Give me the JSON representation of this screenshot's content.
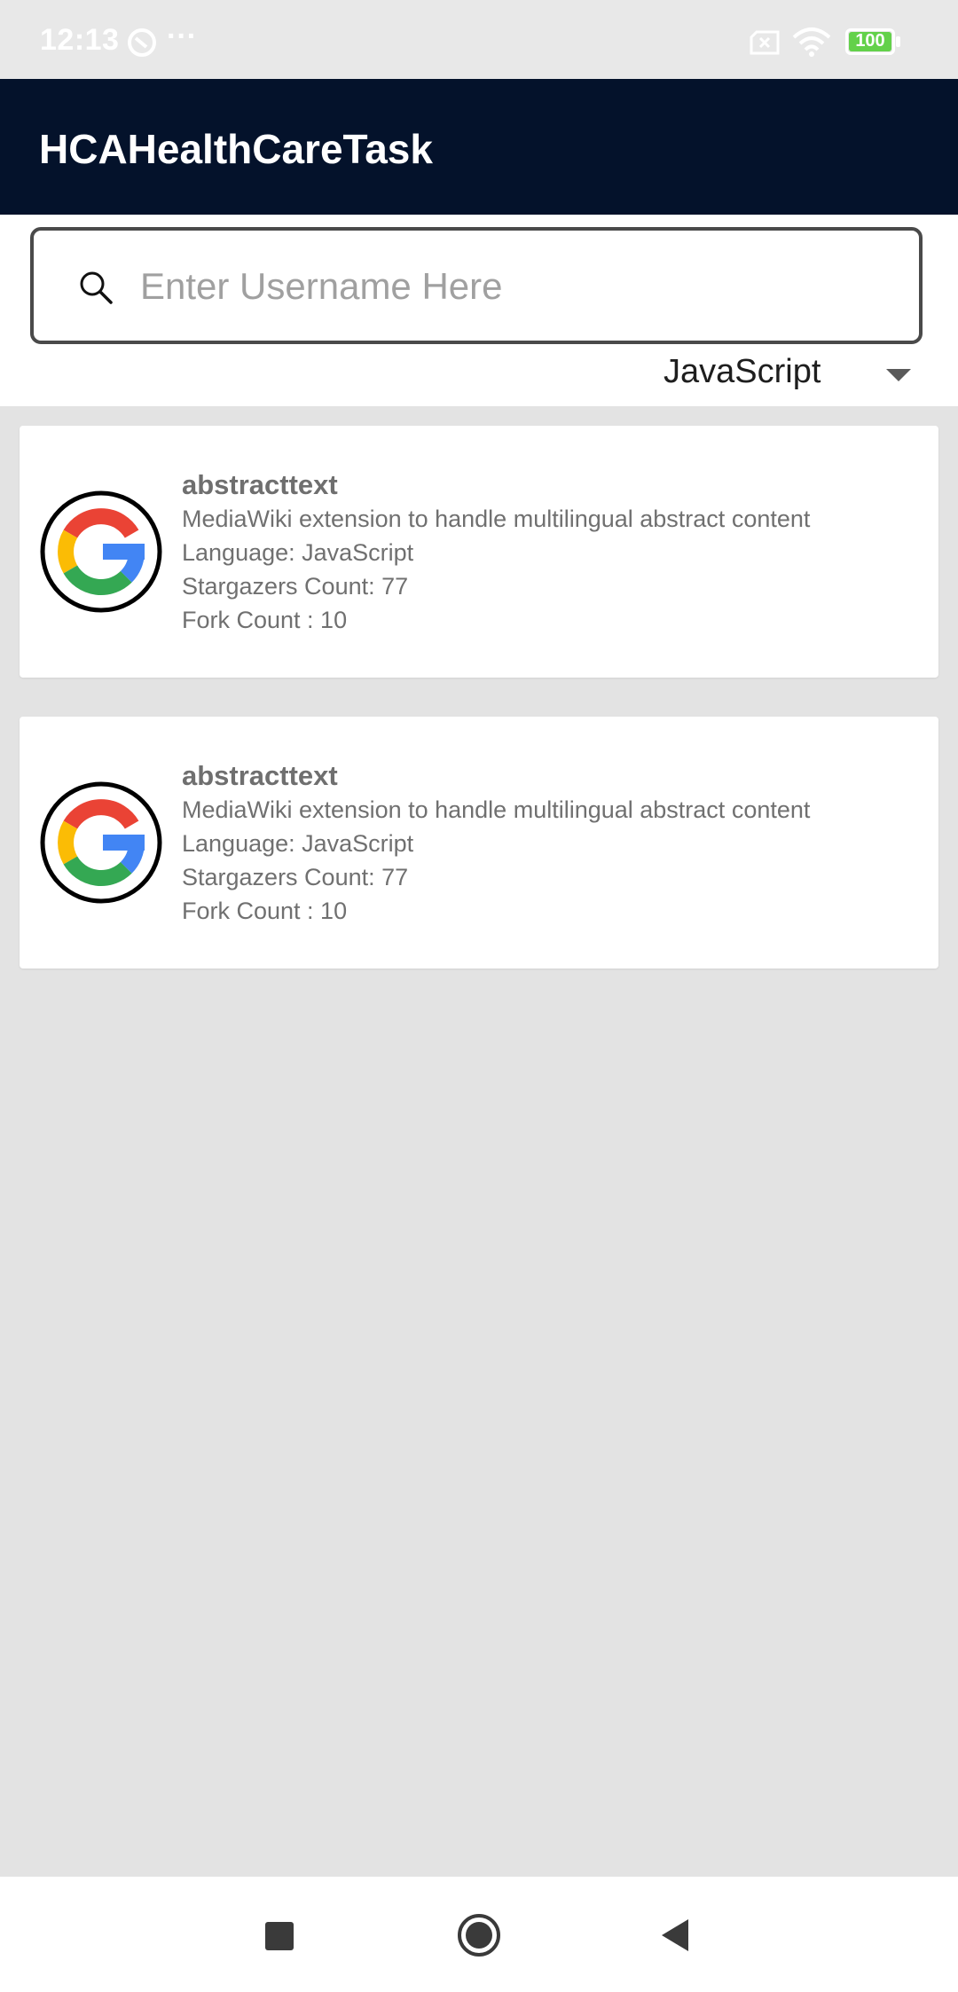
{
  "status_bar": {
    "time": "12:13",
    "more": "···",
    "battery": "100"
  },
  "app_bar": {
    "title": "HCAHealthCareTask"
  },
  "search": {
    "placeholder": "Enter Username Here",
    "value": ""
  },
  "language_filter": {
    "selected": "JavaScript"
  },
  "repos": [
    {
      "name": "abstracttext",
      "description": "MediaWiki extension to handle multilingual abstract content",
      "language": "Language: JavaScript",
      "stargazers": "Stargazers Count: 77",
      "forks": "Fork Count : 10"
    },
    {
      "name": "abstracttext",
      "description": "MediaWiki extension to handle multilingual abstract content",
      "language": "Language: JavaScript",
      "stargazers": "Stargazers Count: 77",
      "forks": "Fork Count : 10"
    }
  ],
  "colors": {
    "app_bar": "#04122b",
    "background": "#e3e3e3",
    "google_red": "#ea4335",
    "google_yellow": "#fbbc05",
    "google_green": "#34a853",
    "google_blue": "#4285f4"
  }
}
